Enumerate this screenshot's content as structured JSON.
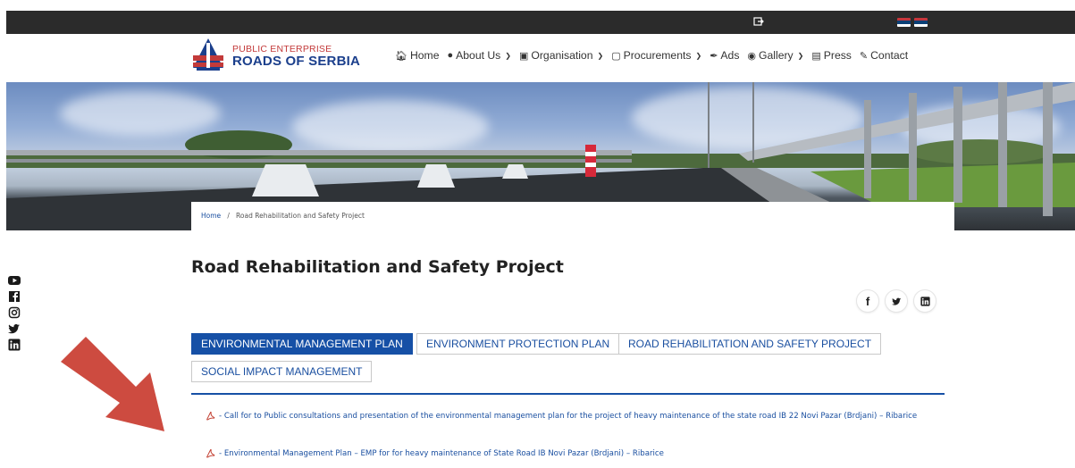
{
  "topbar": {
    "login_icon": "sign-in-icon",
    "flags": [
      "serbian-flag",
      "serbian-flag"
    ]
  },
  "header": {
    "logo_line1": "PUBLIC ENTERPRISE",
    "logo_line2": "ROADS OF SERBIA",
    "nav": [
      {
        "label": "Home",
        "icon": "home-icon",
        "dropdown": false
      },
      {
        "label": "About Us",
        "icon": "user-icon",
        "dropdown": true
      },
      {
        "label": "Organisation",
        "icon": "sitemap-icon",
        "dropdown": true
      },
      {
        "label": "Procurements",
        "icon": "clipboard-icon",
        "dropdown": true
      },
      {
        "label": "Ads",
        "icon": "paperclip-icon",
        "dropdown": false
      },
      {
        "label": "Gallery",
        "icon": "camera-icon",
        "dropdown": true
      },
      {
        "label": "Press",
        "icon": "newspaper-icon",
        "dropdown": false
      },
      {
        "label": "Contact",
        "icon": "edit-icon",
        "dropdown": false
      }
    ]
  },
  "breadcrumb": {
    "home": "Home",
    "separator": "/",
    "current": "Road Rehabilitation and Safety Project"
  },
  "social": [
    "youtube-icon",
    "facebook-icon",
    "instagram-icon",
    "twitter-icon",
    "linkedin-icon"
  ],
  "page": {
    "title": "Road Rehabilitation and Safety Project"
  },
  "share": [
    {
      "icon": "facebook-icon",
      "glyph": "f"
    },
    {
      "icon": "twitter-icon",
      "glyph": "🐦"
    },
    {
      "icon": "linkedin-icon",
      "glyph": "in"
    }
  ],
  "tabs": [
    {
      "label": "ENVIRONMENTAL MANAGEMENT PLAN",
      "active": true
    },
    {
      "label": "ENVIRONMENT PROTECTION PLAN",
      "active": false
    },
    {
      "label": "ROAD REHABILITATION AND SAFETY PROJECT",
      "active": false
    },
    {
      "label": "SOCIAL IMPACT MANAGEMENT",
      "active": false
    }
  ],
  "documents": [
    {
      "text": "- Call for to Public consultations and presentation of the environmental management plan for the project of heavy maintenance of the state road IB 22 Novi Pazar (Brdjani) – Ribarice"
    },
    {
      "text": "- Environmental Management Plan – EMP for for heavy maintenance of State Road IB Novi Pazar (Brdjani) – Ribarice"
    }
  ],
  "colors": {
    "accent": "#1650a6",
    "topbar": "#2b2b2b",
    "annotation_arrow": "#cd4b40"
  }
}
